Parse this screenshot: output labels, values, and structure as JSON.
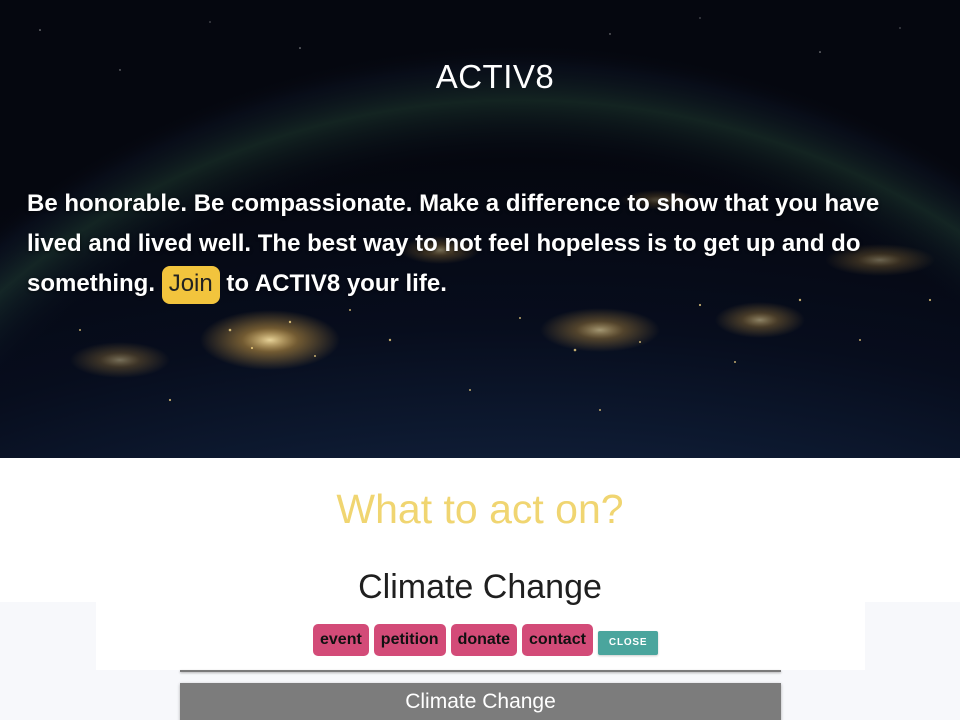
{
  "hero": {
    "title": "ACTIV8",
    "text_before": "Be honorable. Be compassionate. Make a difference to show that you have lived and lived well. The best way to not feel hopeless is to get up and do something.",
    "join_label": "Join",
    "text_after": "to ACTIV8 your life."
  },
  "section": {
    "heading": "What to act on?"
  },
  "cause_card": {
    "title": "Climate Change",
    "actions": [
      {
        "label": "event"
      },
      {
        "label": "petition"
      },
      {
        "label": "donate"
      },
      {
        "label": "contact"
      }
    ],
    "close_label": "CLOSE"
  },
  "accordion": {
    "label": "Climate Change"
  },
  "colors": {
    "join_accent": "#f2c43d",
    "heading_accent": "#f0d571",
    "action_buttons": "#d34b78",
    "close_button": "#4aa59d",
    "accordion_bar": "#7c7c7c"
  }
}
